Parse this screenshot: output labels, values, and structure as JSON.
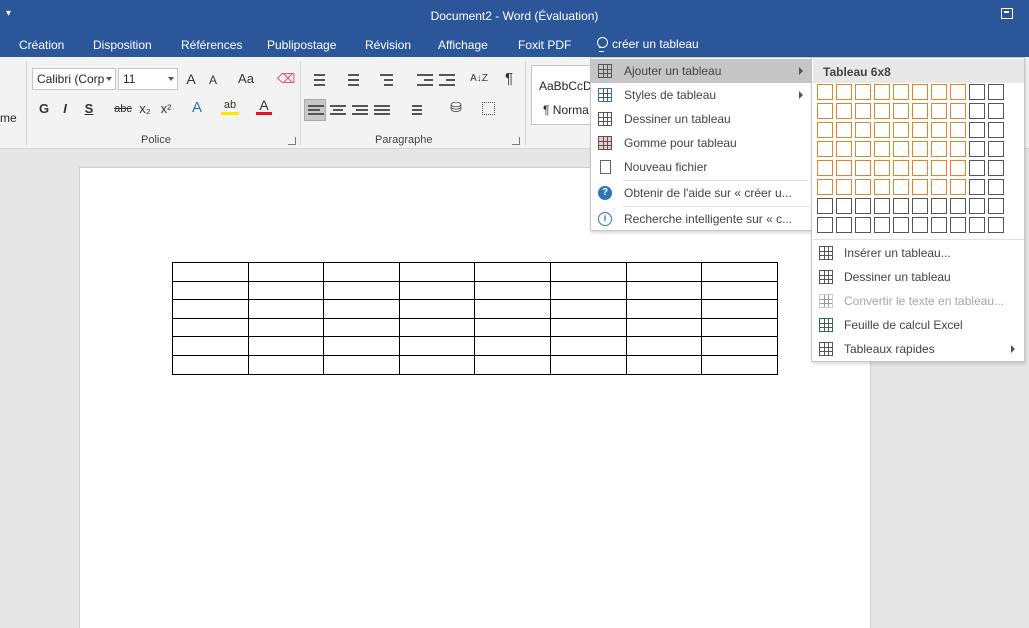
{
  "window": {
    "title": "Document2 - Word (Évaluation)",
    "qat_icon": "customize-qat-icon",
    "restore_icon": "ribbon-display-options-icon"
  },
  "tabs": [
    {
      "label": "Création"
    },
    {
      "label": "Disposition"
    },
    {
      "label": "Références"
    },
    {
      "label": "Publipostage"
    },
    {
      "label": "Révision"
    },
    {
      "label": "Affichage"
    },
    {
      "label": "Foxit PDF"
    }
  ],
  "tell_me": {
    "label": "créer un tableau",
    "icon": "lightbulb-icon"
  },
  "ribbon": {
    "clipboard_partial_label": "me",
    "font": {
      "name": "Calibri (Corp",
      "size": "11",
      "group_label": "Police",
      "grow": "A",
      "shrink": "A",
      "case": "Aa",
      "bold": "G",
      "italic": "I",
      "underline": "S",
      "strike": "abc",
      "subscript": "x₂",
      "superscript": "x²",
      "effects": "A",
      "highlight": "ab",
      "color": "A"
    },
    "paragraph": {
      "group_label": "Paragraphe",
      "sort": "A↓Z",
      "pilcrow": "¶"
    },
    "styles": {
      "preview": "AaBbCcD",
      "normal": "¶ Norma"
    }
  },
  "menu1": {
    "items": [
      {
        "label": "Ajouter un tableau",
        "icon": "table-icon",
        "submenu": true
      },
      {
        "label": "Styles de tableau",
        "icon": "table-styles-icon",
        "submenu": true
      },
      {
        "label": "Dessiner un tableau",
        "icon": "draw-table-icon"
      },
      {
        "label": "Gomme pour tableau",
        "icon": "table-eraser-icon"
      },
      {
        "label": "Nouveau fichier",
        "icon": "new-file-icon"
      },
      {
        "label": "Obtenir de l'aide sur « créer u...",
        "icon": "help-icon"
      },
      {
        "label": "Recherche intelligente sur « c...",
        "icon": "smart-lookup-icon"
      }
    ]
  },
  "menu2": {
    "header": "Tableau 6x8",
    "grid": {
      "cols": 10,
      "rows": 8,
      "selected_cols": 8,
      "selected_rows": 6
    },
    "items": [
      {
        "label": "Insérer un tableau...",
        "icon": "insert-table-icon"
      },
      {
        "label": "Dessiner un tableau",
        "icon": "draw-table-icon"
      },
      {
        "label": "Convertir le texte en tableau...",
        "icon": "convert-text-icon",
        "disabled": true
      },
      {
        "label": "Feuille de calcul Excel",
        "icon": "excel-sheet-icon"
      },
      {
        "label": "Tableaux rapides",
        "icon": "quick-tables-icon",
        "submenu": true
      }
    ]
  },
  "document": {
    "table": {
      "rows": 6,
      "cols": 8
    }
  },
  "colors": {
    "accent": "#2b579a",
    "grid_selected": "#e3842d",
    "font_color": "#e81123",
    "highlight": "#ffe600"
  }
}
